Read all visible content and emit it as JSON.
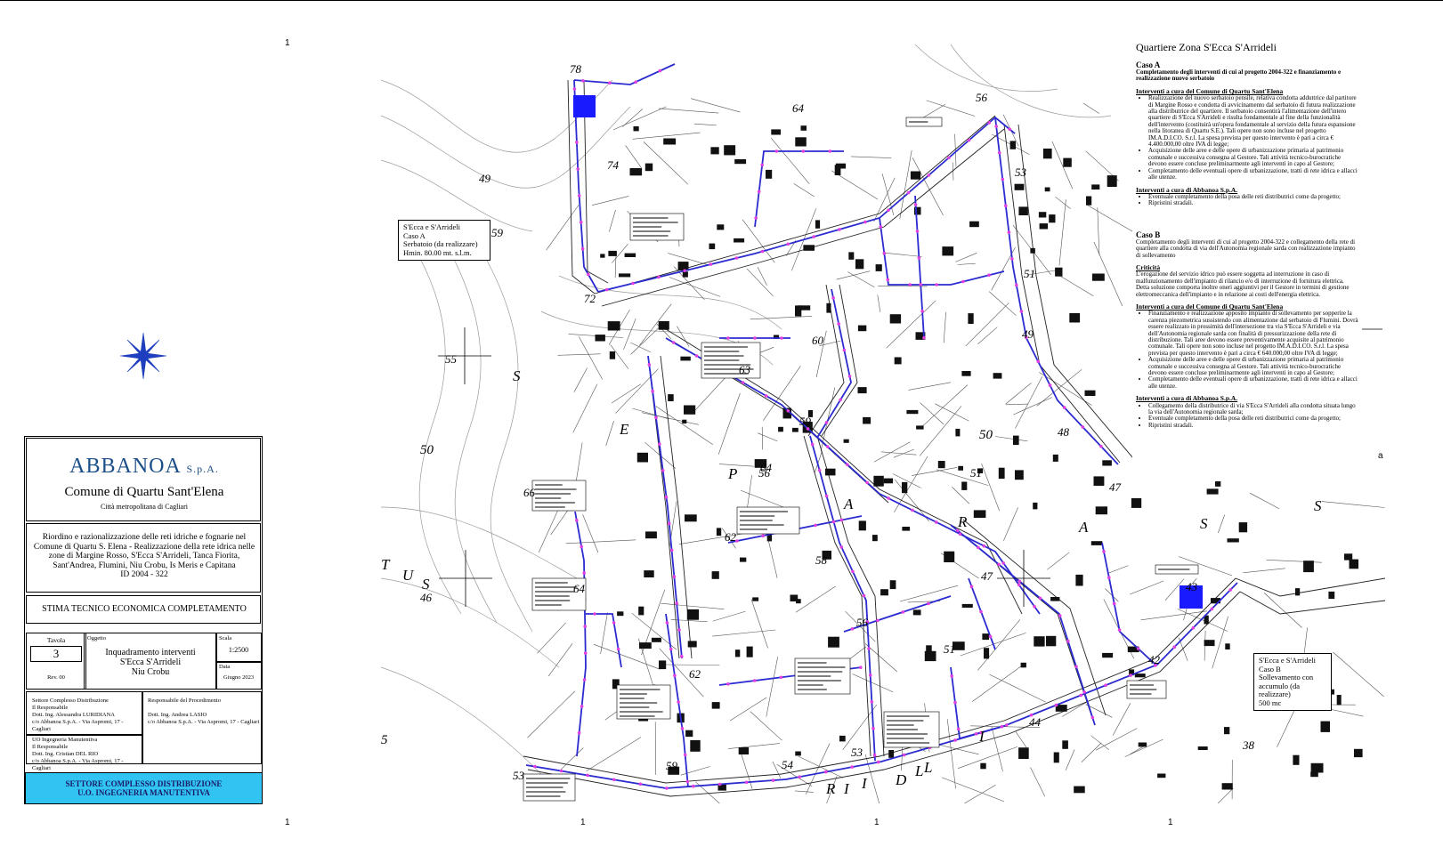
{
  "sheet_marks": [
    "1",
    "1",
    "1",
    "1",
    "1",
    "a"
  ],
  "title_block": {
    "logo_text": "ABBANOA",
    "logo_suffix": "S.p.A.",
    "municipality": "Comune di Quartu Sant'Elena",
    "metro_area": "Città metropolitana di Cagliari",
    "project_lines": [
      "Riordino e razionalizzazione delle reti idriche e fognarie nel",
      "Comune di Quartu S. Elena - Realizzazione della rete idrica nelle",
      "zone di Margine Rosso, S'Ecca S'Arrideli, Tanca Fiorita,",
      "Sant'Andrea, Flumini, Niu Crobu, Is Meris e Capitana",
      "ID 2004 - 322"
    ],
    "document_title": "STIMA TECNICO ECONOMICA COMPLETAMENTO",
    "tavola_label": "Tavola",
    "tavola_number": "3",
    "rev": "Rev. 00",
    "oggetto_label": "Oggetto",
    "oggetto_lines": [
      "Inquadramento interventi",
      "S'Ecca S'Arrideli",
      "Niu Crobu"
    ],
    "scala_label": "Scala",
    "scala": "1:2500",
    "data_label": "Data",
    "data": "Giugno 2023",
    "resp_left": [
      "Settore Complesso Distribuzione",
      "Il Responsabile",
      "Dott. Ing. Alessandra LURIDIANA",
      "c/o Abbanoa S.p.A. - Via Aspromi, 17 - Cagliari"
    ],
    "resp_right": [
      "Responsabile del Procedimento",
      "Dott. Ing. Andrea LASIO",
      "c/o Abbanoa S.p.A. - Via Aspromi, 17 - Cagliari"
    ],
    "resp_bottom": [
      "UO Ingegneria Manutentiva",
      "Il Responsabile",
      "Dott. Ing. Cristian DEL RIO",
      "c/o Abbanoa S.p.A. - Via Aspromi, 17 - Cagliari"
    ],
    "settore_lines": [
      "SETTORE COMPLESSO DISTRIBUZIONE",
      "U.O. INGEGNERIA MANUTENTIVA"
    ]
  },
  "panel": {
    "title": "Quartiere Zona S'Ecca S'Arrideli",
    "caso_a_heading": "Caso A",
    "caso_a_sub": "Completamento degli interventi di cui al progetto 2004-322 e finanziamento e realizzazione nuovo serbatoio",
    "a_comune_heading": "Interventi a cura del Comune di Quartu Sant'Elena",
    "a_comune_items": [
      "Realizzazione del nuovo serbatoio pensile, relativa condotta adduttrice dal partitore di Margine Rosso e condotta di avvicinamento dal serbatoio di futura realizzazione alla distributrice del quartiere. Il serbatoio consentirà l'alimentazione dell'intero quartiere di S'Ecca S'Arrideli e risulta fondamentale al fine della funzionalità dell'intervento (costituirà un'opera fondamentale al servizio della futura espansione nella litoranea di Quartu S.E.). Tali opere non sono incluse nel progetto IM.A.D.I.CO. S.r.l. La spesa prevista per questo intervento è pari a circa € 4.400.000,00 oltre IVA di legge;",
      "Acquisizione delle aree e delle opere di urbanizzazione primaria al patrimonio comunale e successiva consegna al Gestore. Tali attività tecnico-burocratiche devono essere concluse preliminarmente agli interventi in capo al Gestore;",
      "Completamento delle eventuali opere di urbanizzazione, tratti di rete idrica e allacci alle utenze."
    ],
    "a_abbanoa_heading": "Interventi a cura di Abbanoa S.p.A.",
    "a_abbanoa_items": [
      "Eventuale completamento della posa delle reti distributrici come da progetto;",
      "Ripristini stradali."
    ],
    "caso_b_heading": "Caso B",
    "caso_b_sub": "Completamento degli interventi di cui al progetto 2004-322 e collegamento della rete di quartiere alla condotta di via dell'Autonomia regionale sarda con realizzazione impianto di sollevamento",
    "criticita_heading": "Criticità",
    "criticita_text": "L'erogazione del servizio idrico può essere soggetta ad interruzione in caso di malfunzionamento dell'impianto di rilancio e/o di interruzione di fornitura elettrica. Detta soluzione comporta inoltre oneri aggiuntivi per il Gestore in termini di gestione elettromeccanica dell'impianto e in relazione ai costi dell'energia elettrica.",
    "b_comune_heading": "Interventi a cura del Comune di Quartu Sant'Elena",
    "b_comune_items": [
      "Finanziamento e realizzazione apposito impianto di sollevamento per sopperire la carenza piezometrica sussistendo con alimentazione dal serbatoio di Flumini. Dovrà essere realizzato in prossimità dell'intersezione tra via S'Ecca S'Arrideli e via dell'Autonomia regionale sarda con finalità di pressurizzazione della rete di distribuzione. Tali aree devono essere preventivamente acquisite al patrimonio comunale. Tali opere non sono incluse nel progetto IM.A.D.I.CO. S.r.l. La spesa prevista per questo intervento è pari a circa € 640.000,00 oltre IVA di legge;",
      "Acquisizione delle aree e delle opere di urbanizzazione primaria al patrimonio comunale e successiva consegna al Gestore. Tali attività tecnico-burocratiche devono essere concluse preliminarmente agli interventi in capo al Gestore;",
      "Completamento delle eventuali opere di urbanizzazione, tratti di rete idrica e allacci alle utenze."
    ],
    "b_abbanoa_heading": "Interventi a cura di Abbanoa S.p.A.",
    "b_abbanoa_items": [
      "Collegamento della distributrice di via S'Ecca S'Arrideli alla condotta situata lungo la via dell'Autonomia regionale sarda;",
      "Eventuale completamento della posa delle reti distributrici come da progetto;",
      "Ripristini stradali."
    ]
  },
  "callout_a": [
    "S'Ecca e S'Arrideli",
    "Caso A",
    "Serbatoio (da realizzare)",
    "Hmin. 80.00 mt. s.l.m."
  ],
  "callout_b": [
    "S'Ecca e S'Arrideli",
    "Caso B",
    "Sollevamento con",
    "accumulo (da realizzare)",
    "500 mc"
  ],
  "map_numbers": [
    "78",
    "74",
    "64",
    "56",
    "53",
    "51",
    "49",
    "48",
    "50",
    "51",
    "47",
    "43",
    "42",
    "44",
    "38",
    "49",
    "59",
    "72",
    "55",
    "60",
    "63",
    "59",
    "64",
    "56",
    "62",
    "58",
    "56",
    "47",
    "51",
    "53",
    "54",
    "59",
    "62",
    "66",
    "64",
    "46",
    "53",
    "50",
    "5"
  ],
  "street_letters": [
    "S",
    "E",
    "P",
    "A",
    "R",
    "A",
    "S",
    "S",
    "T",
    "U",
    "S",
    "I",
    "L",
    "D",
    "I",
    "R",
    "I",
    "L"
  ],
  "colors": {
    "network": "#2b2bd0",
    "nodes": "#e040e0",
    "tank": "#1a1aff",
    "settore_fill": "#31c4f3",
    "logo": "#1b4f8a",
    "compass": "#1f3fbf"
  }
}
